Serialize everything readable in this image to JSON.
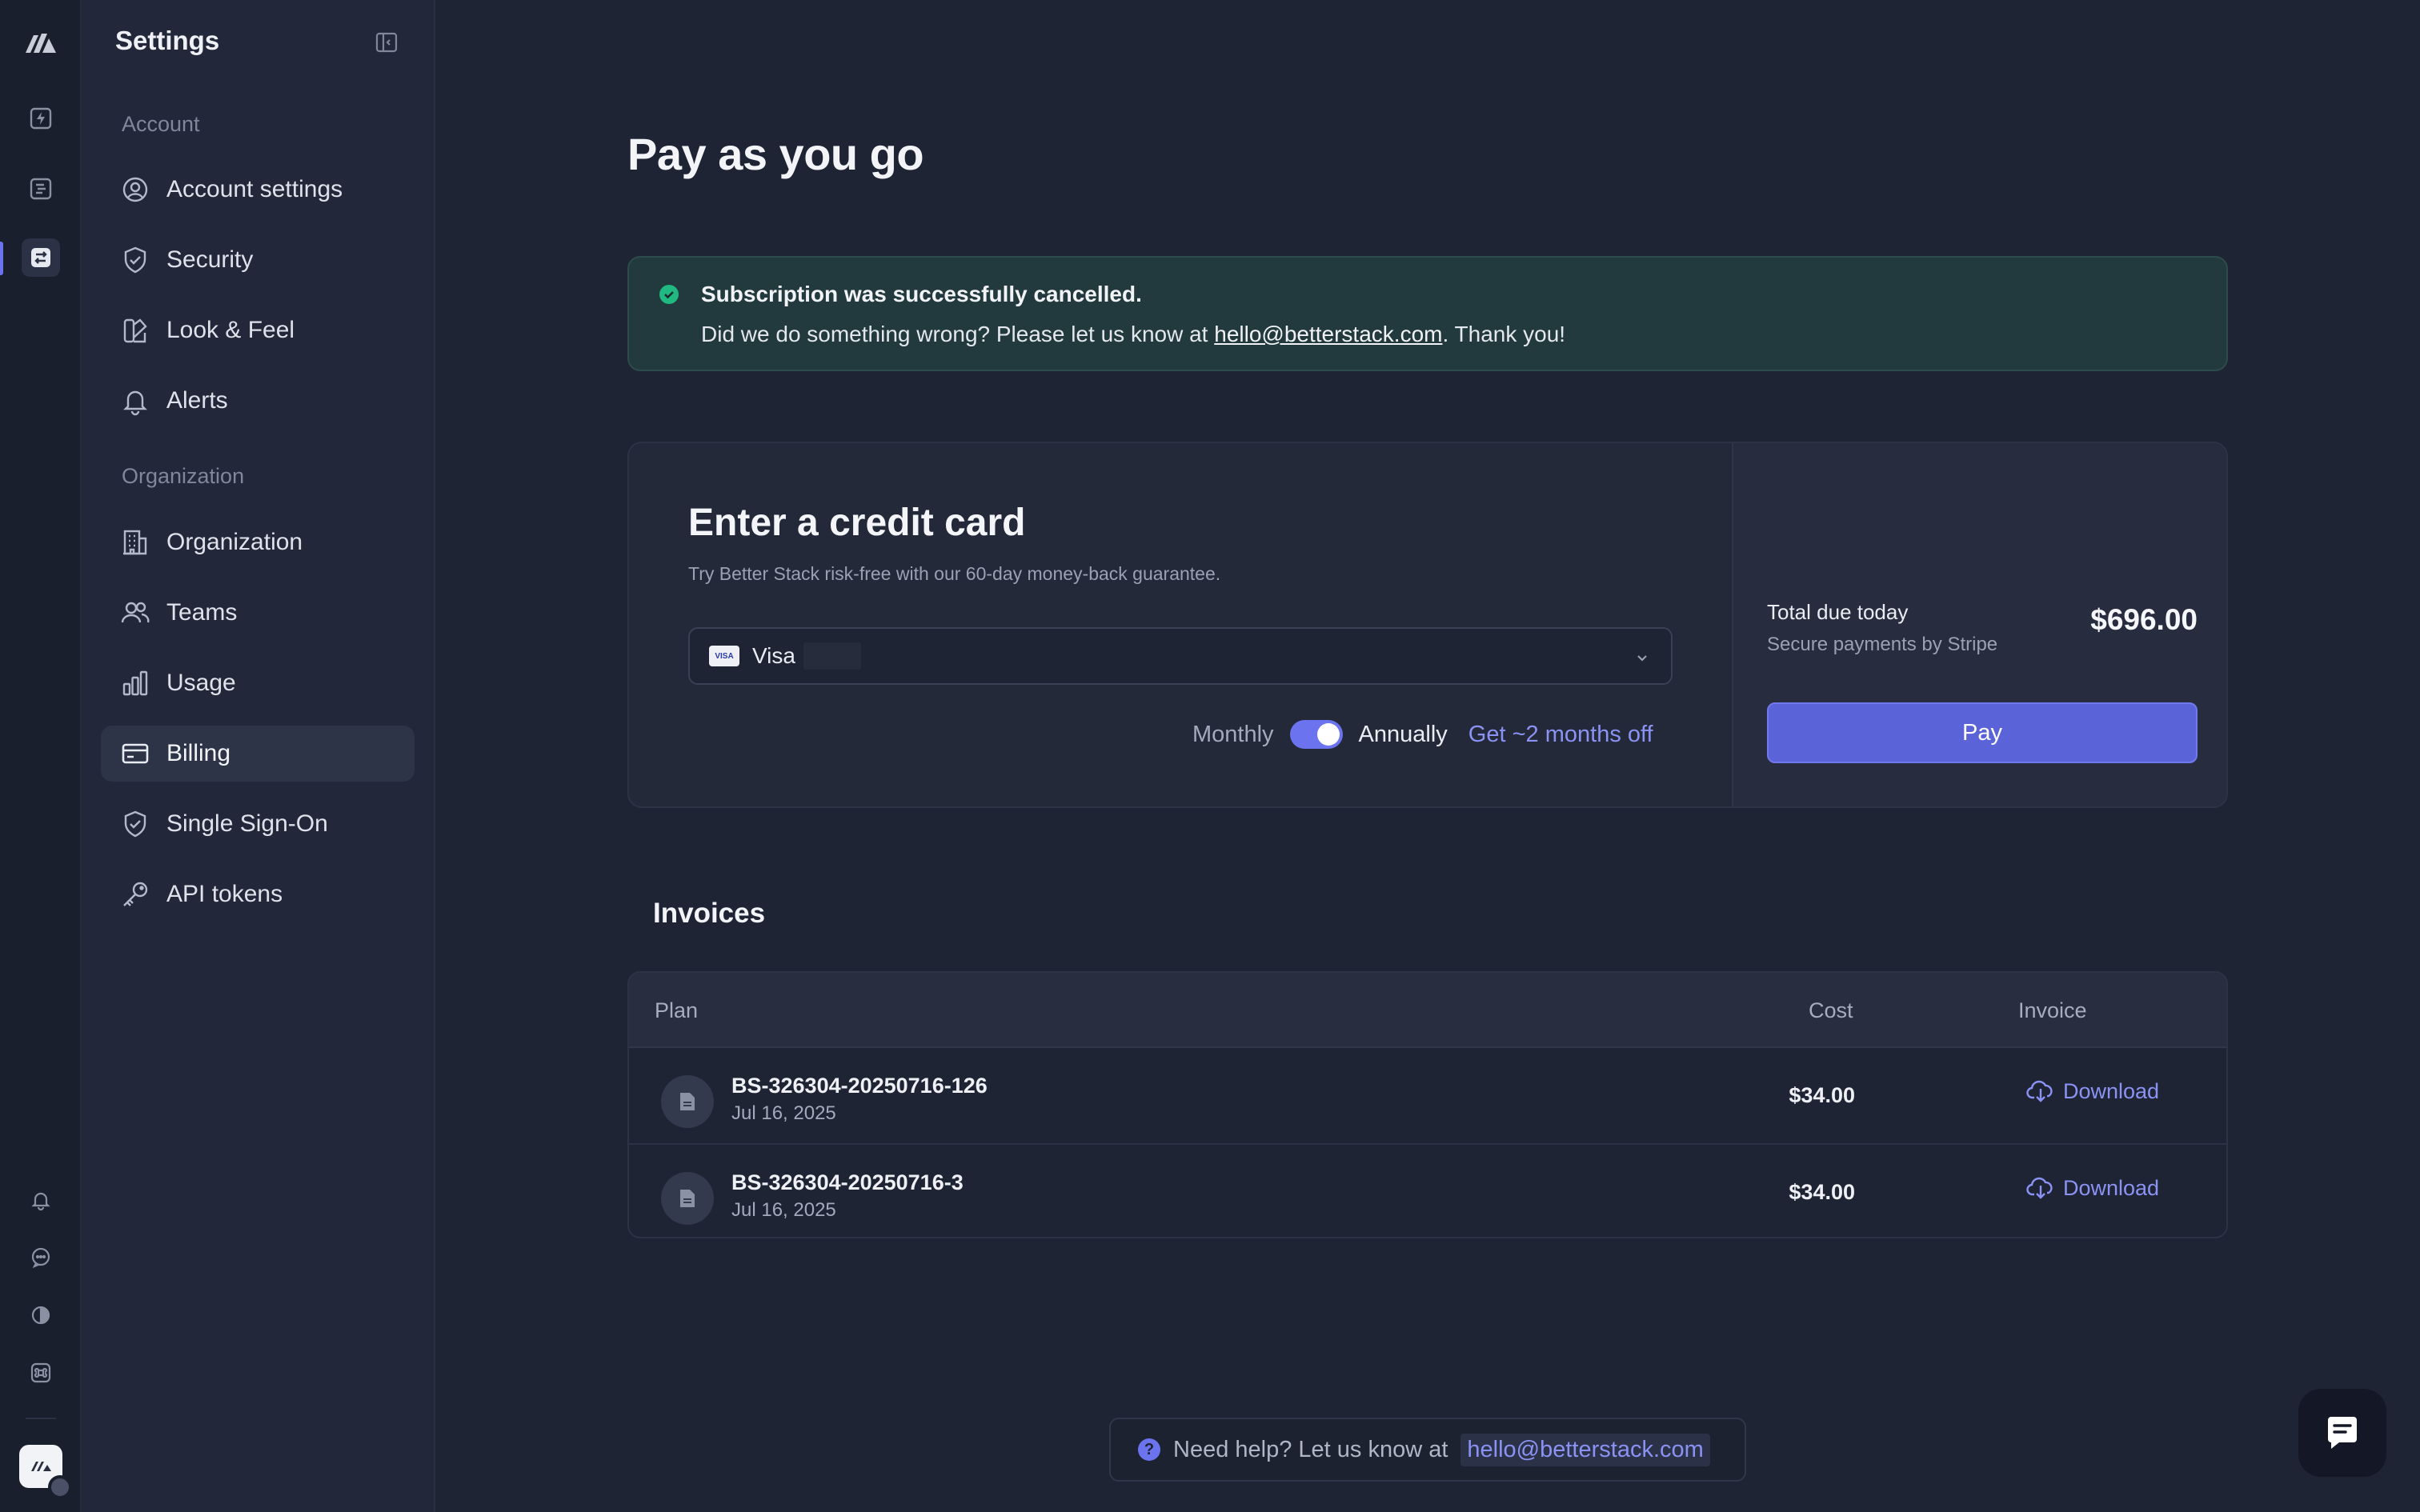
{
  "sidebar": {
    "title": "Settings",
    "sections": [
      {
        "label": "Account",
        "items": [
          {
            "label": "Account settings",
            "icon": "user-circle-icon"
          },
          {
            "label": "Security",
            "icon": "shield-check-icon"
          },
          {
            "label": "Look & Feel",
            "icon": "palette-icon"
          },
          {
            "label": "Alerts",
            "icon": "bell-icon"
          }
        ]
      },
      {
        "label": "Organization",
        "items": [
          {
            "label": "Organization",
            "icon": "building-icon"
          },
          {
            "label": "Teams",
            "icon": "users-icon"
          },
          {
            "label": "Usage",
            "icon": "bar-chart-icon"
          },
          {
            "label": "Billing",
            "icon": "credit-card-icon",
            "active": true
          },
          {
            "label": "Single Sign-On",
            "icon": "shield-check-icon"
          },
          {
            "label": "API tokens",
            "icon": "key-icon"
          }
        ]
      }
    ]
  },
  "main": {
    "title": "Pay as you go",
    "alert": {
      "title": "Subscription was successfully cancelled.",
      "message_prefix": "Did we do something wrong? Please let us know at ",
      "email": "hello@betterstack.com",
      "message_suffix": ". Thank you!"
    },
    "credit_card": {
      "title": "Enter a credit card",
      "subtitle": "Try Better Stack risk-free with our 60-day money-back guarantee.",
      "selected_card": "Visa",
      "card_brand_badge": "VISA",
      "toggle": {
        "monthly_label": "Monthly",
        "annual_label": "Annually",
        "discount_label": "Get ~2 months off",
        "annual_selected": true
      },
      "total_label": "Total due today",
      "total_sub": "Secure payments by Stripe",
      "total_amount": "$696.00",
      "pay_label": "Pay"
    },
    "invoices": {
      "title": "Invoices",
      "columns": {
        "plan": "Plan",
        "cost": "Cost",
        "invoice": "Invoice"
      },
      "rows": [
        {
          "id": "BS-326304-20250716-126",
          "date": "Jul 16, 2025",
          "cost": "$34.00",
          "action": "Download"
        },
        {
          "id": "BS-326304-20250716-3",
          "date": "Jul 16, 2025",
          "cost": "$34.00",
          "action": "Download"
        }
      ]
    },
    "help": {
      "text": "Need help? Let us know at",
      "email": "hello@betterstack.com"
    }
  },
  "colors": {
    "background": "#1f2435",
    "accent": "#6b74ee",
    "pay_button": "#5b63d9",
    "success": "#1fb981",
    "link": "#8a93f4"
  }
}
